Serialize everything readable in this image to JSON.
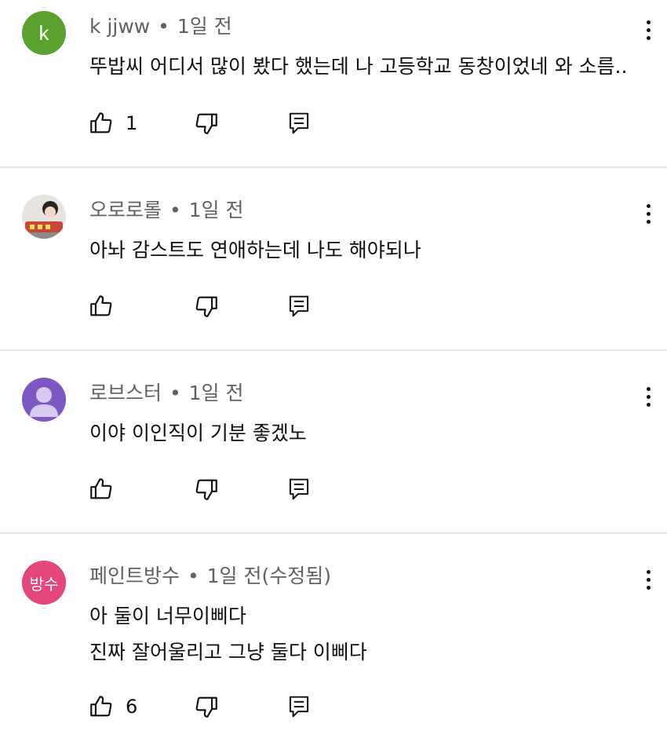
{
  "comments": [
    {
      "author": "k jjww",
      "time": "1일 전",
      "avatar_text": "k",
      "avatar_color": "#5aa12d",
      "lines": [
        "뚜밥씨 어디서 많이 봤다 했는데 나 고등학교 동창이었네 와 소름.."
      ],
      "likes": "1"
    },
    {
      "author": "오로로롤",
      "time": "1일 전",
      "avatar_text": "",
      "avatar_color": "#d9d4cf",
      "lines": [
        "아놔 감스트도 연애하는데 나도 해야되나"
      ],
      "likes": ""
    },
    {
      "author": "로브스터",
      "time": "1일 전",
      "avatar_text": "",
      "avatar_color": "#7e57c2",
      "lines": [
        "이야 이인직이 기분 좋겠노"
      ],
      "likes": ""
    },
    {
      "author": "페인트방수",
      "time": "1일 전(수정됨)",
      "avatar_text": "방수",
      "avatar_color": "#e54679",
      "lines": [
        "아 둘이 너무이삐다",
        "진짜 잘어울리고 그냥 둘다 이삐다"
      ],
      "likes": "6"
    }
  ],
  "icons": {
    "like": "thumbs-up-icon",
    "dislike": "thumbs-down-icon",
    "reply": "reply-comment-icon",
    "more": "more-vertical-icon"
  }
}
